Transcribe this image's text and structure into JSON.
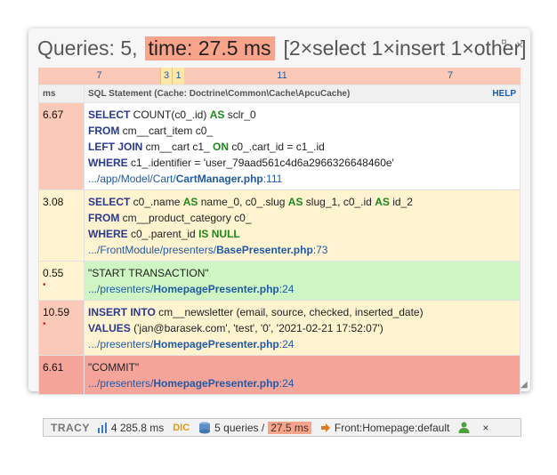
{
  "panel": {
    "title": "Queries: 5,",
    "time": "time: 27.5 ms",
    "summary": "[2×select 1×insert 1×other]",
    "pin_icon": "¤",
    "close_icon": "×"
  },
  "timeline": [
    "7",
    "3",
    "1",
    "11",
    "7"
  ],
  "table": {
    "col_ms": "ms",
    "col_sql": "SQL Statement (Cache: Doctrine\\Common\\Cache\\ApcuCache)",
    "help": "HELP"
  },
  "rows": [
    {
      "ms": "6.67",
      "lines": [
        [
          [
            "kw",
            "SELECT"
          ],
          [
            "t",
            " COUNT(c0_.id) "
          ],
          [
            "kw2",
            "AS"
          ],
          [
            "t",
            " sclr_0"
          ]
        ],
        [
          [
            "kw",
            "FROM"
          ],
          [
            "t",
            " cm__cart_item c0_"
          ]
        ],
        [
          [
            "kw",
            "LEFT JOIN"
          ],
          [
            "t",
            " cm__cart c1_ "
          ],
          [
            "kw2",
            "ON"
          ],
          [
            "t",
            " c0_.cart_id = c1_.id"
          ]
        ],
        [
          [
            "kw",
            "WHERE"
          ],
          [
            "t",
            " c1_.identifier = 'user_79aad561c4d6a2966326648460e'"
          ]
        ]
      ],
      "src_path": ".../app/Model/Cart/",
      "src_file": "CartManager.php",
      "src_line": ":111"
    },
    {
      "ms": "3.08",
      "lines": [
        [
          [
            "kw",
            "SELECT"
          ],
          [
            "t",
            " c0_.name "
          ],
          [
            "kw2",
            "AS"
          ],
          [
            "t",
            " name_0, c0_.slug "
          ],
          [
            "kw2",
            "AS"
          ],
          [
            "t",
            " slug_1, c0_.id "
          ],
          [
            "kw2",
            "AS"
          ],
          [
            "t",
            " id_2"
          ]
        ],
        [
          [
            "kw",
            "FROM"
          ],
          [
            "t",
            " cm__product_category c0_"
          ]
        ],
        [
          [
            "kw",
            "WHERE"
          ],
          [
            "t",
            " c0_.parent_id "
          ],
          [
            "kw2",
            "IS NULL"
          ]
        ]
      ],
      "src_path": ".../FrontModule/presenters/",
      "src_file": "BasePresenter.php",
      "src_line": ":73"
    },
    {
      "ms": "0.55",
      "dot": "•",
      "lines": [
        [
          [
            "t",
            "\"START TRANSACTION\""
          ]
        ]
      ],
      "src_path": ".../presenters/",
      "src_file": "HomepagePresenter.php",
      "src_line": ":24"
    },
    {
      "ms": "10.59",
      "dot": "•",
      "lines": [
        [
          [
            "kw",
            "INSERT INTO"
          ],
          [
            "t",
            " cm__newsletter (email, source, checked, inserted_date)"
          ]
        ],
        [
          [
            "kw",
            "VALUES"
          ],
          [
            "t",
            " ('jan@barasek.com', 'test', '0', '2021-02-21 17:52:07')"
          ]
        ]
      ],
      "src_path": ".../presenters/",
      "src_file": "HomepagePresenter.php",
      "src_line": ":24"
    },
    {
      "ms": "6.61",
      "lines": [
        [
          [
            "t",
            "\"COMMIT\""
          ]
        ]
      ],
      "src_path": ".../presenters/",
      "src_file": "HomepagePresenter.php",
      "src_line": ":24"
    }
  ],
  "bar": {
    "logo": "TRACY",
    "time": "4 285.8 ms",
    "dic": "DIC",
    "queries": "5 queries /",
    "queries_time": "27.5 ms",
    "route": "Front:Homepage:default",
    "close": "×"
  }
}
